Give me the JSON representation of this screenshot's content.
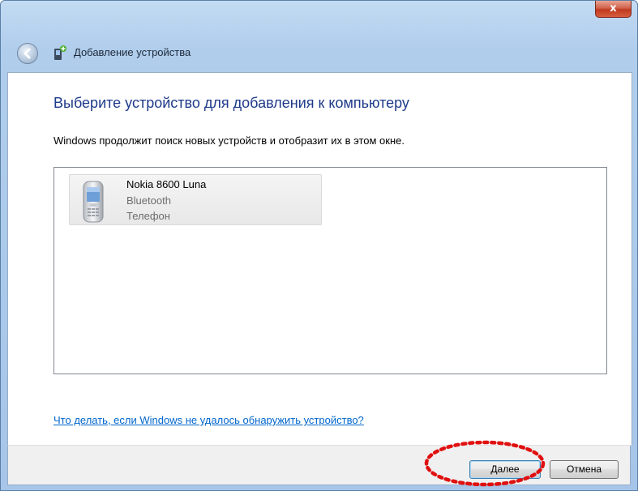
{
  "window": {
    "close_label": "x"
  },
  "navbar": {
    "title": "Добавление устройства"
  },
  "main": {
    "heading": "Выберите устройство для добавления к компьютеру",
    "subtext": "Windows продолжит поиск новых устройств и отобразит их в этом окне.",
    "devices": [
      {
        "name": "Nokia 8600 Luna",
        "connection": "Bluetooth",
        "category": "Телефон",
        "icon": "mobile-phone-icon"
      }
    ],
    "help_link": "Что делать, если Windows не удалось обнаружить устройство?"
  },
  "footer": {
    "next_label": "Далее",
    "cancel_label": "Отмена"
  },
  "colors": {
    "heading": "#1e3a8a",
    "link": "#0066cc",
    "annotation": "#e01010"
  }
}
